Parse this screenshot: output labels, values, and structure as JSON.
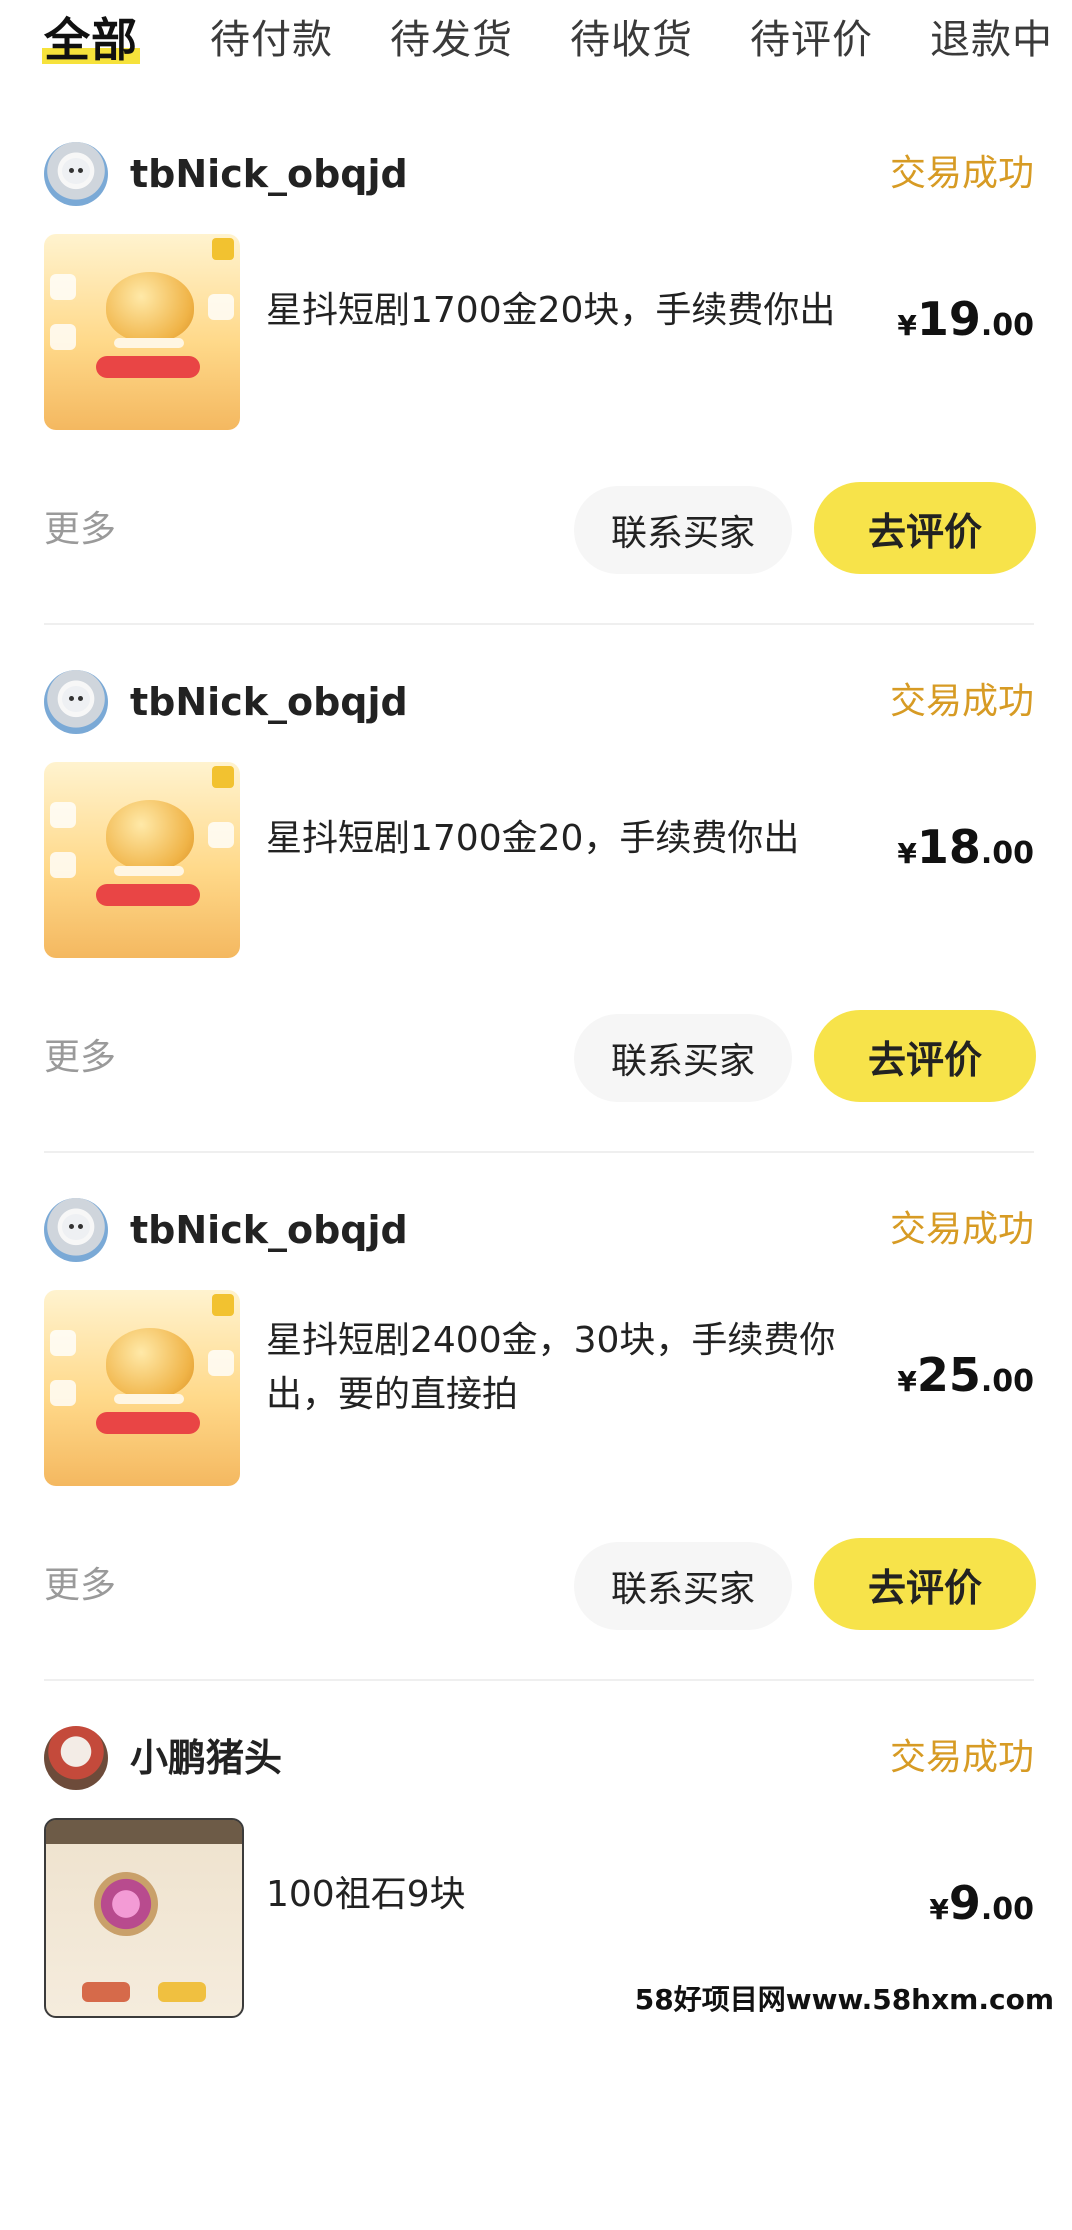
{
  "tabs": [
    {
      "label": "全部",
      "active": true
    },
    {
      "label": "待付款"
    },
    {
      "label": "待发货"
    },
    {
      "label": "待收货"
    },
    {
      "label": "待评价"
    },
    {
      "label": "退款中"
    }
  ],
  "orders": [
    {
      "seller": "tbNick_obqjd",
      "status": "交易成功",
      "title": "星抖短剧1700金20块，手续费你出",
      "price": {
        "currency": "¥",
        "int": "19",
        "dec": ".00"
      },
      "more": "更多",
      "contact_label": "联系买家",
      "review_label": "去评价"
    },
    {
      "seller": "tbNick_obqjd",
      "status": "交易成功",
      "title": "星抖短剧1700金20，手续费你出",
      "price": {
        "currency": "¥",
        "int": "18",
        "dec": ".00"
      },
      "more": "更多",
      "contact_label": "联系买家",
      "review_label": "去评价"
    },
    {
      "seller": "tbNick_obqjd",
      "status": "交易成功",
      "title": "星抖短剧2400金，30块，手续费你出，要的直接拍",
      "price": {
        "currency": "¥",
        "int": "25",
        "dec": ".00"
      },
      "more": "更多",
      "contact_label": "联系买家",
      "review_label": "去评价"
    },
    {
      "seller": "小鹏猪头",
      "status": "交易成功",
      "title": "100祖石9块",
      "price": {
        "currency": "¥",
        "int": "9",
        "dec": ".00"
      }
    }
  ],
  "watermark": "58好项目网www.58hxm.com",
  "colors": {
    "accent": "#f7e34a",
    "status": "#d79b24"
  }
}
